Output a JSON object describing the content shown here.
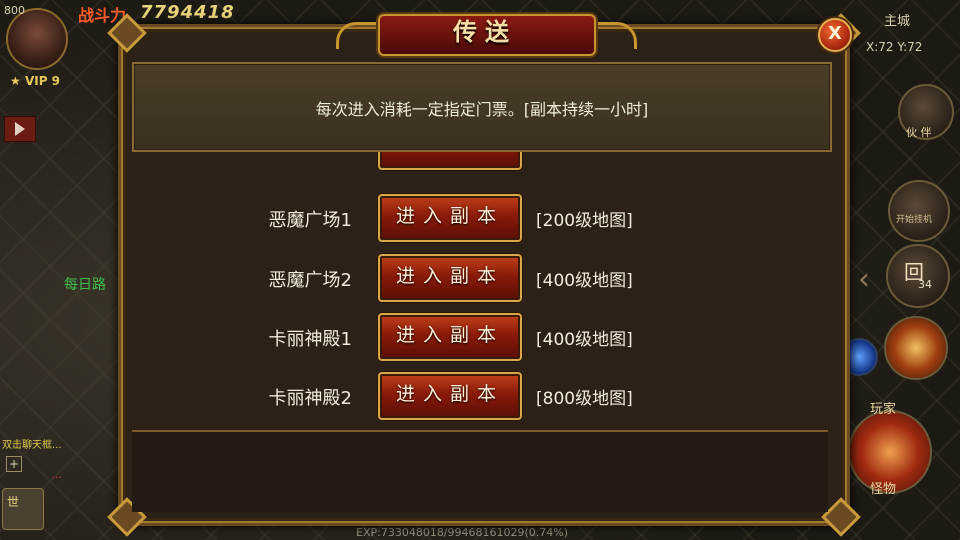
{
  "hud": {
    "gold": "800",
    "power_label": "战斗力",
    "power_value": "7794418",
    "vip": "VIP 9",
    "green_text": "每日路",
    "chat_line_1": "双击聊天框...",
    "chat_line_2": "...",
    "mic_label": "世",
    "exp": "EXP:733048018/99468161029(0.74%)",
    "city": "主城",
    "coords": "X:72 Y:72",
    "partner_label": "伙 伴",
    "hangup_label": "开始挂机",
    "return_label": "回",
    "return_count": "34",
    "player_label": "玩家",
    "monster_label": "怪物"
  },
  "dialog": {
    "title": "传送",
    "close_label": "X",
    "notice": "每次进入消耗一定指定门票。[副本持续一小时]",
    "rows": [
      {
        "name": "恶魔广场1",
        "button": "进入副本",
        "level": "[200级地图]"
      },
      {
        "name": "恶魔广场2",
        "button": "进入副本",
        "level": "[400级地图]"
      },
      {
        "name": "卡丽神殿1",
        "button": "进入副本",
        "level": "[400级地图]"
      },
      {
        "name": "卡丽神殿2",
        "button": "进入副本",
        "level": "[800级地图]"
      }
    ]
  }
}
